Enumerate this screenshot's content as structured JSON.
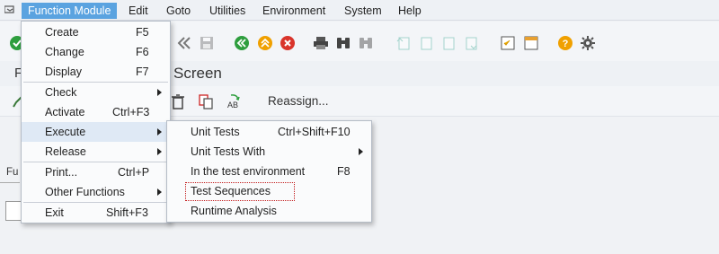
{
  "menubar": {
    "items": [
      "Function Module",
      "Edit",
      "Goto",
      "Utilities",
      "Environment",
      "System",
      "Help"
    ]
  },
  "screen": {
    "title_left": "F",
    "title": "Screen",
    "reassign_label": "Reassign...",
    "field_label_partial": "Fu"
  },
  "function_module_menu": {
    "items": [
      {
        "label": "Create",
        "shortcut": "F5"
      },
      {
        "label": "Change",
        "shortcut": "F6"
      },
      {
        "label": "Display",
        "shortcut": "F7"
      },
      {
        "label": "Check",
        "shortcut": ""
      },
      {
        "label": "Activate",
        "shortcut": "Ctrl+F3"
      },
      {
        "label": "Execute",
        "shortcut": ""
      },
      {
        "label": "Release",
        "shortcut": ""
      },
      {
        "label": "Print...",
        "shortcut": "Ctrl+P"
      },
      {
        "label": "Other Functions",
        "shortcut": ""
      },
      {
        "label": "Exit",
        "shortcut": "Shift+F3"
      }
    ]
  },
  "execute_submenu": {
    "items": [
      {
        "label": "Unit Tests",
        "shortcut": "Ctrl+Shift+F10"
      },
      {
        "label": "Unit Tests With",
        "shortcut": ""
      },
      {
        "label": "In the test environment",
        "shortcut": "F8"
      },
      {
        "label": "Test Sequences",
        "shortcut": ""
      },
      {
        "label": "Runtime Analysis",
        "shortcut": ""
      }
    ]
  },
  "colors": {
    "menu_active": "#5aa3e0",
    "highlight_box": "#c21a1a",
    "ok_green": "#2e9e3e",
    "cancel_red": "#d9342b",
    "help_orange": "#f0a000"
  }
}
